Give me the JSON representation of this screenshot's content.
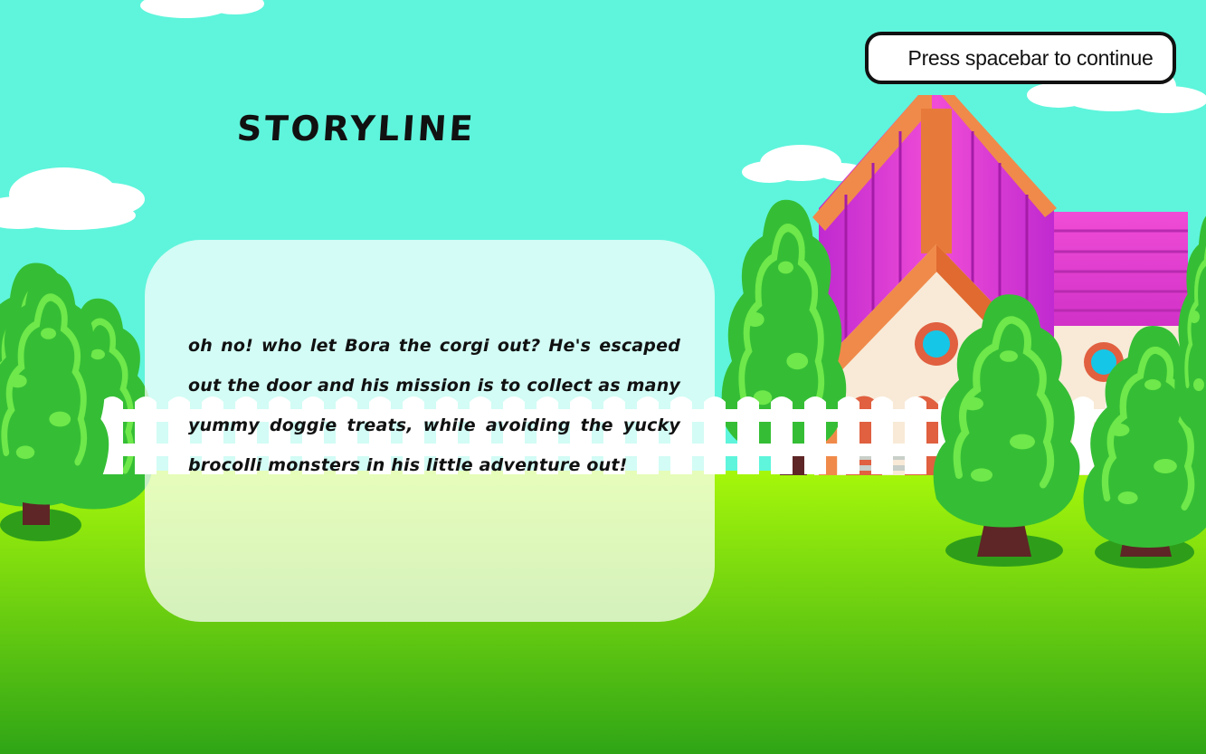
{
  "scene": {
    "colors": {
      "sky": "#5ef5dc",
      "grass_top": "#a6f70a",
      "grass_bottom": "#2fa516",
      "tree_foliage": "#37c437",
      "tree_highlight": "#6ee84a",
      "tree_trunk": "#5e2626",
      "fence": "#ffffff",
      "house_roof_orange": "#f08a4a",
      "house_roof_pink": "#e93fd2",
      "house_wall": "#f8ead7",
      "window_blue": "#16c6e6"
    },
    "icons": [
      "cloud-icon",
      "tree-icon",
      "house-icon",
      "fence-icon"
    ]
  },
  "continue_prompt": {
    "label": "Press spacebar to continue"
  },
  "story": {
    "title": "STORYLINE",
    "text": "oh no! who let Bora the corgi out? He's escaped out the door and his mission is to collect as many yummy doggie treats, while avoiding the yucky brocolli monsters in his little adventure out!"
  }
}
